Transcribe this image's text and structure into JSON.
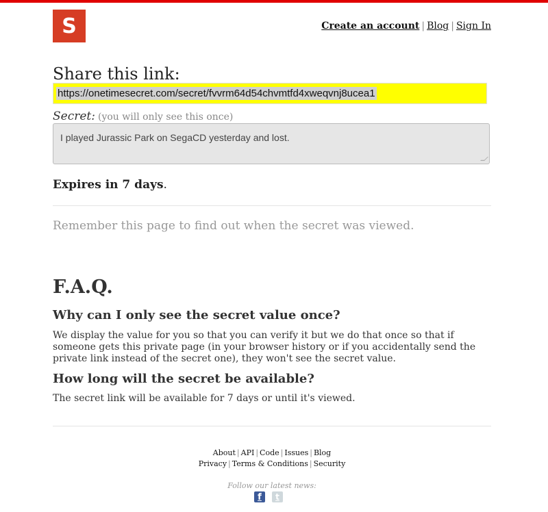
{
  "brand": {
    "logo_letter": "S",
    "accent_color": "#d63d24",
    "topbar_color": "#e00000"
  },
  "nav": {
    "create_account": "Create an account",
    "blog": "Blog",
    "sign_in": "Sign In",
    "separator": "|"
  },
  "share": {
    "title": "Share this link:",
    "link": "https://onetimesecret.com/secret/fvvrm64d54chvmtfd4xweqvnj8ucea1",
    "highlight_color": "#ffff00"
  },
  "secret": {
    "label": "Secret:",
    "note": "(you will only see this once)",
    "value": "I played Jurassic Park on SegaCD yesterday and lost."
  },
  "expires": {
    "text": "Expires in 7 days",
    "suffix": "."
  },
  "remember": "Remember this page to find out when the secret was viewed.",
  "faq": {
    "title": "F.A.Q.",
    "items": [
      {
        "q": "Why can I only see the secret value once?",
        "a": "We display the value for you so that you can verify it but we do that once so that if someone gets this private page (in your browser history or if you accidentally send the private link instead of the secret one), they won't see the secret value."
      },
      {
        "q": "How long will the secret be available?",
        "a": "The secret link will be available for 7 days or until it's viewed."
      }
    ]
  },
  "footer": {
    "row1": [
      "About",
      "API",
      "Code",
      "Issues",
      "Blog"
    ],
    "row2": [
      "Privacy",
      "Terms & Conditions",
      "Security"
    ],
    "follow": "Follow our latest news:",
    "social": [
      {
        "icon": "facebook-icon",
        "glyph": "f"
      },
      {
        "icon": "twitter-icon",
        "glyph": "t"
      }
    ]
  }
}
